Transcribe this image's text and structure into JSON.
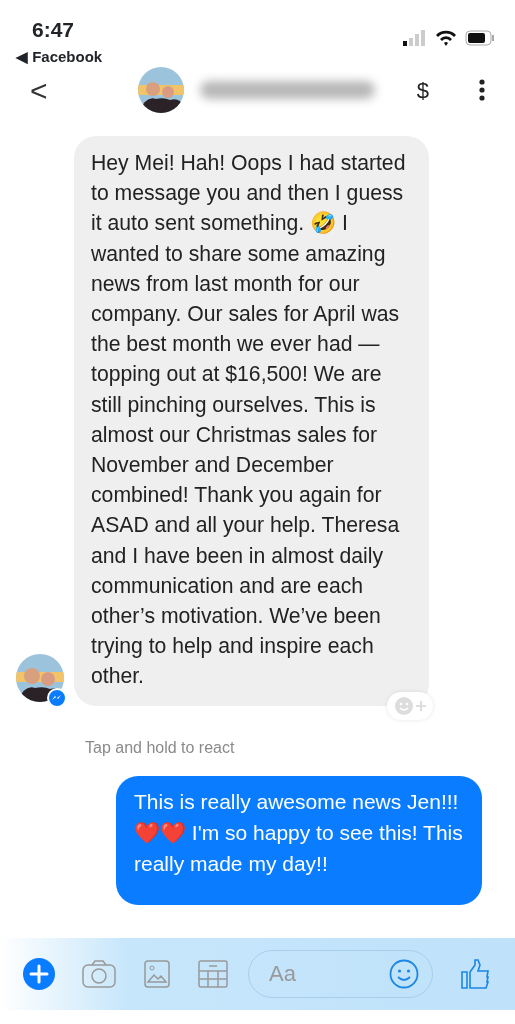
{
  "status_bar": {
    "time": "6:47",
    "back_app": "◀ Facebook"
  },
  "header": {
    "back": "<",
    "money": "$"
  },
  "messages": [
    {
      "kind": "incoming",
      "text": "Hey Mei! Hah! Oops I had started to message you and then I guess it auto sent something. 🤣 I wanted to share some amazing news from last month for our company. Our sales for April was the best month we ever had — topping out at $16,500! We are still pinching ourselves. This is almost our Christmas sales for November and December combined! Thank you again for ASAD and all your help. Theresa and I have been in almost daily communication and are each other’s motivation. We’ve been trying to help and inspire each other."
    },
    {
      "kind": "hint",
      "text": "Tap and hold to react"
    },
    {
      "kind": "outgoing",
      "text": "This is really awesome news Jen!!! ❤️❤️ I'm so happy to see this! This really made my day!!"
    }
  ],
  "composer": {
    "placeholder": "Aa"
  }
}
